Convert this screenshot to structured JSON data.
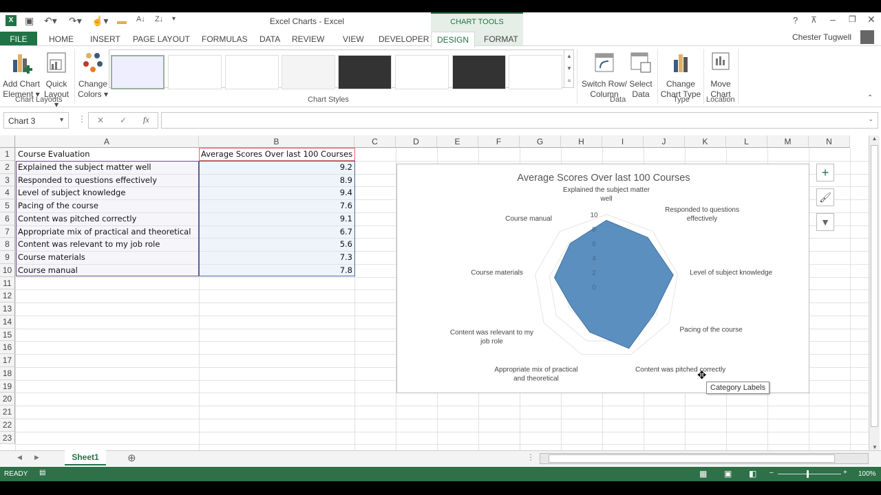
{
  "window": {
    "title": "Excel Charts - Excel",
    "context_tab": "CHART TOOLS",
    "user": "Chester Tugwell"
  },
  "tabs": [
    "FILE",
    "HOME",
    "INSERT",
    "PAGE LAYOUT",
    "FORMULAS",
    "DATA",
    "REVIEW",
    "VIEW",
    "DEVELOPER",
    "DESIGN",
    "FORMAT"
  ],
  "ribbon": {
    "add_chart_element": [
      "Add Chart",
      "Element ▾"
    ],
    "quick_layout": [
      "Quick",
      "Layout ▾"
    ],
    "change_colors": [
      "Change",
      "Colors ▾"
    ],
    "switch_row_col": [
      "Switch Row/",
      "Column"
    ],
    "select_data": [
      "Select",
      "Data"
    ],
    "change_chart_type": [
      "Change",
      "Chart Type"
    ],
    "move_chart": [
      "Move",
      "Chart"
    ],
    "groups": {
      "chart_layouts": "Chart Layouts",
      "chart_styles": "Chart Styles",
      "data": "Data",
      "type": "Type",
      "location": "Location"
    }
  },
  "formula_bar": {
    "name_box": "Chart 3",
    "value": ""
  },
  "columns": [
    "A",
    "B",
    "C",
    "D",
    "E",
    "F",
    "G",
    "H",
    "I",
    "J",
    "K",
    "L",
    "M",
    "N"
  ],
  "rows": [
    "1",
    "2",
    "3",
    "4",
    "5",
    "6",
    "7",
    "8",
    "9",
    "10",
    "11",
    "12",
    "13",
    "14",
    "15",
    "16",
    "17",
    "18",
    "19",
    "20",
    "21",
    "22",
    "23"
  ],
  "table": {
    "headers": [
      "Course Evaluation",
      "Average Scores Over last 100 Courses"
    ],
    "rows": [
      [
        "Explained the subject matter well",
        "9.2"
      ],
      [
        "Responded to questions effectively",
        "8.9"
      ],
      [
        "Level of subject knowledge",
        "9.4"
      ],
      [
        "Pacing of the course",
        "7.6"
      ],
      [
        "Content was pitched correctly",
        "9.1"
      ],
      [
        "Appropriate mix of practical and theoretical",
        "6.7"
      ],
      [
        "Content was relevant to my job role",
        "5.6"
      ],
      [
        "Course materials",
        "7.3"
      ],
      [
        "Course manual",
        "7.8"
      ]
    ]
  },
  "chart_data": {
    "type": "radar",
    "title": "Average Scores Over last 100 Courses",
    "categories": [
      [
        "Explained the subject matter",
        "well"
      ],
      [
        "Responded to questions",
        "effectively"
      ],
      [
        "Level of subject knowledge"
      ],
      [
        "Pacing of the course"
      ],
      [
        "Content was pitched correctly"
      ],
      [
        "Appropriate mix of practical",
        "and theoretical"
      ],
      [
        "Content was relevant to my",
        "job role"
      ],
      [
        "Course materials"
      ],
      [
        "Course manual"
      ]
    ],
    "values": [
      9.2,
      8.9,
      9.4,
      7.6,
      9.1,
      6.7,
      5.6,
      7.3,
      7.8
    ],
    "ticks": [
      "0",
      "2",
      "4",
      "6",
      "8",
      "10"
    ],
    "range": [
      0,
      10
    ],
    "fill_color": "#5b8fc0",
    "tooltip": "Category Labels"
  },
  "sheet_tab": "Sheet1",
  "status": {
    "ready": "READY",
    "zoom": "100%"
  },
  "colors": {
    "excel_green": "#217346",
    "status_green": "#2e7047"
  }
}
